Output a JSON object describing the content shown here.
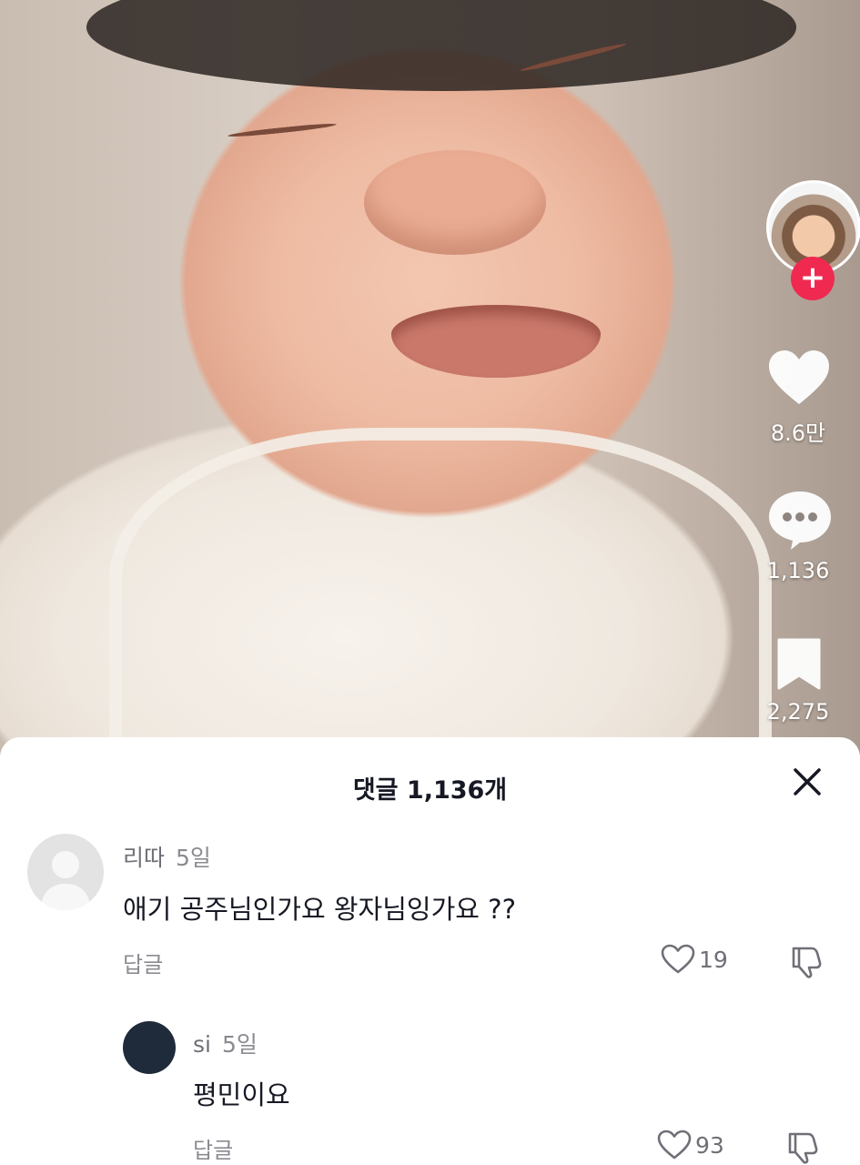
{
  "video": {
    "creator_follow_icon": "plus-icon",
    "likes": "8.6만",
    "comments": "1,136",
    "saves": "2,275"
  },
  "comments_sheet": {
    "title": "댓글 1,136개",
    "close_icon": "close-icon",
    "comments": [
      {
        "username": "리따",
        "time": "5일",
        "text": "애기 공주님인가요 왕자님잉가요 ??",
        "reply_label": "답글",
        "likes": "19"
      },
      {
        "username": "si",
        "time": "5일",
        "text": "평민이요",
        "reply_label": "답글",
        "likes": "93"
      }
    ]
  },
  "colors": {
    "accent": "#ef2950",
    "text_primary": "#161823",
    "text_secondary": "#8a8b91"
  }
}
